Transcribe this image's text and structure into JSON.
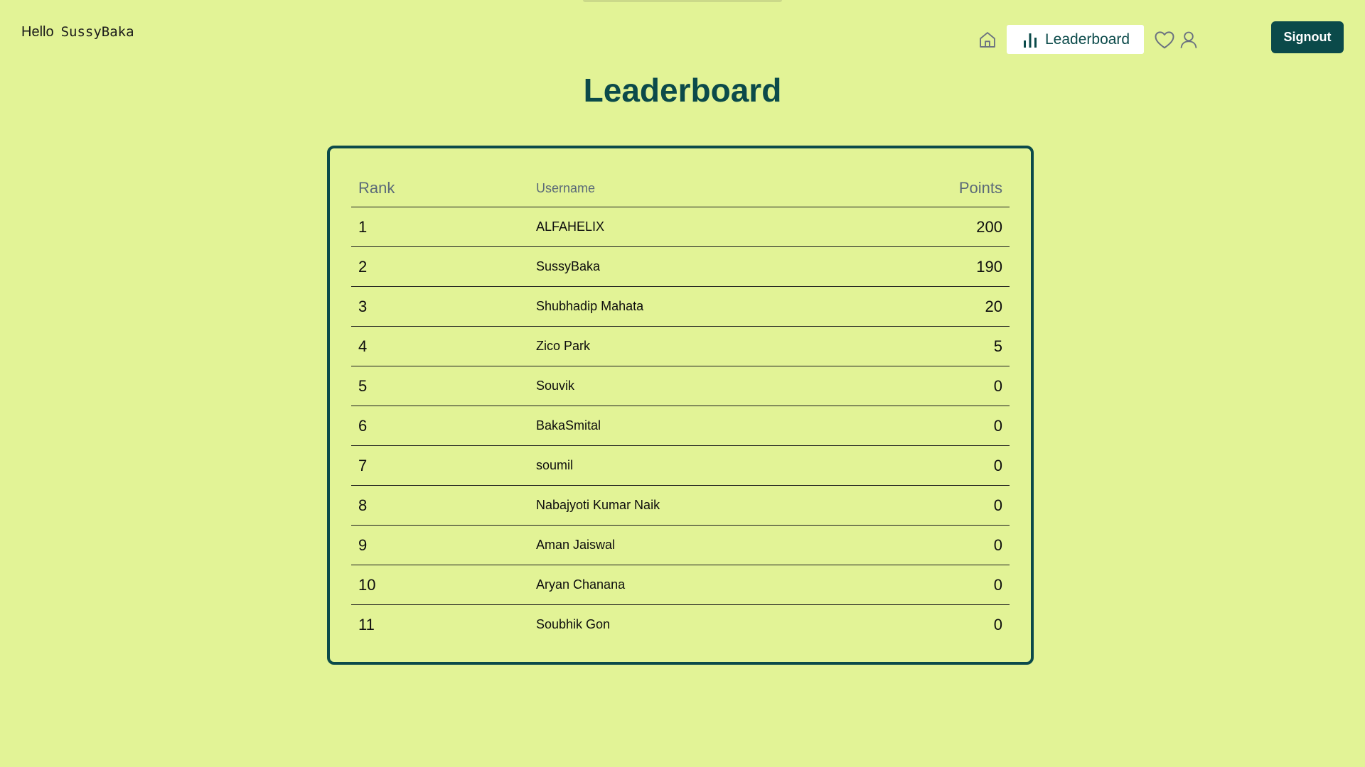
{
  "header": {
    "greeting_word": "Hello",
    "username": "SussyBaka",
    "nav": {
      "home_icon": "home-icon",
      "active_label": "Leaderboard",
      "active_icon": "bar-chart-icon",
      "favorites_icon": "heart-icon",
      "profile_icon": "user-icon"
    },
    "signout_label": "Signout"
  },
  "page": {
    "title": "Leaderboard"
  },
  "leaderboard": {
    "columns": [
      "Rank",
      "Username",
      "Points"
    ],
    "rows": [
      {
        "rank": "1",
        "username": "ALFAHELIX",
        "points": "200"
      },
      {
        "rank": "2",
        "username": "SussyBaka",
        "points": "190"
      },
      {
        "rank": "3",
        "username": "Shubhadip Mahata",
        "points": "20"
      },
      {
        "rank": "4",
        "username": "Zico Park",
        "points": "5"
      },
      {
        "rank": "5",
        "username": "Souvik",
        "points": "0"
      },
      {
        "rank": "6",
        "username": "BakaSmital",
        "points": "0"
      },
      {
        "rank": "7",
        "username": "soumil",
        "points": "0"
      },
      {
        "rank": "8",
        "username": "Nabajyoti Kumar Naik",
        "points": "0"
      },
      {
        "rank": "9",
        "username": "Aman Jaiswal",
        "points": "0"
      },
      {
        "rank": "10",
        "username": "Aryan Chanana",
        "points": "0"
      },
      {
        "rank": "11",
        "username": "Soubhik Gon",
        "points": "0"
      }
    ]
  },
  "colors": {
    "background": "#e2f396",
    "accent": "#0b4a4a",
    "header_text": "#5b6a78"
  }
}
